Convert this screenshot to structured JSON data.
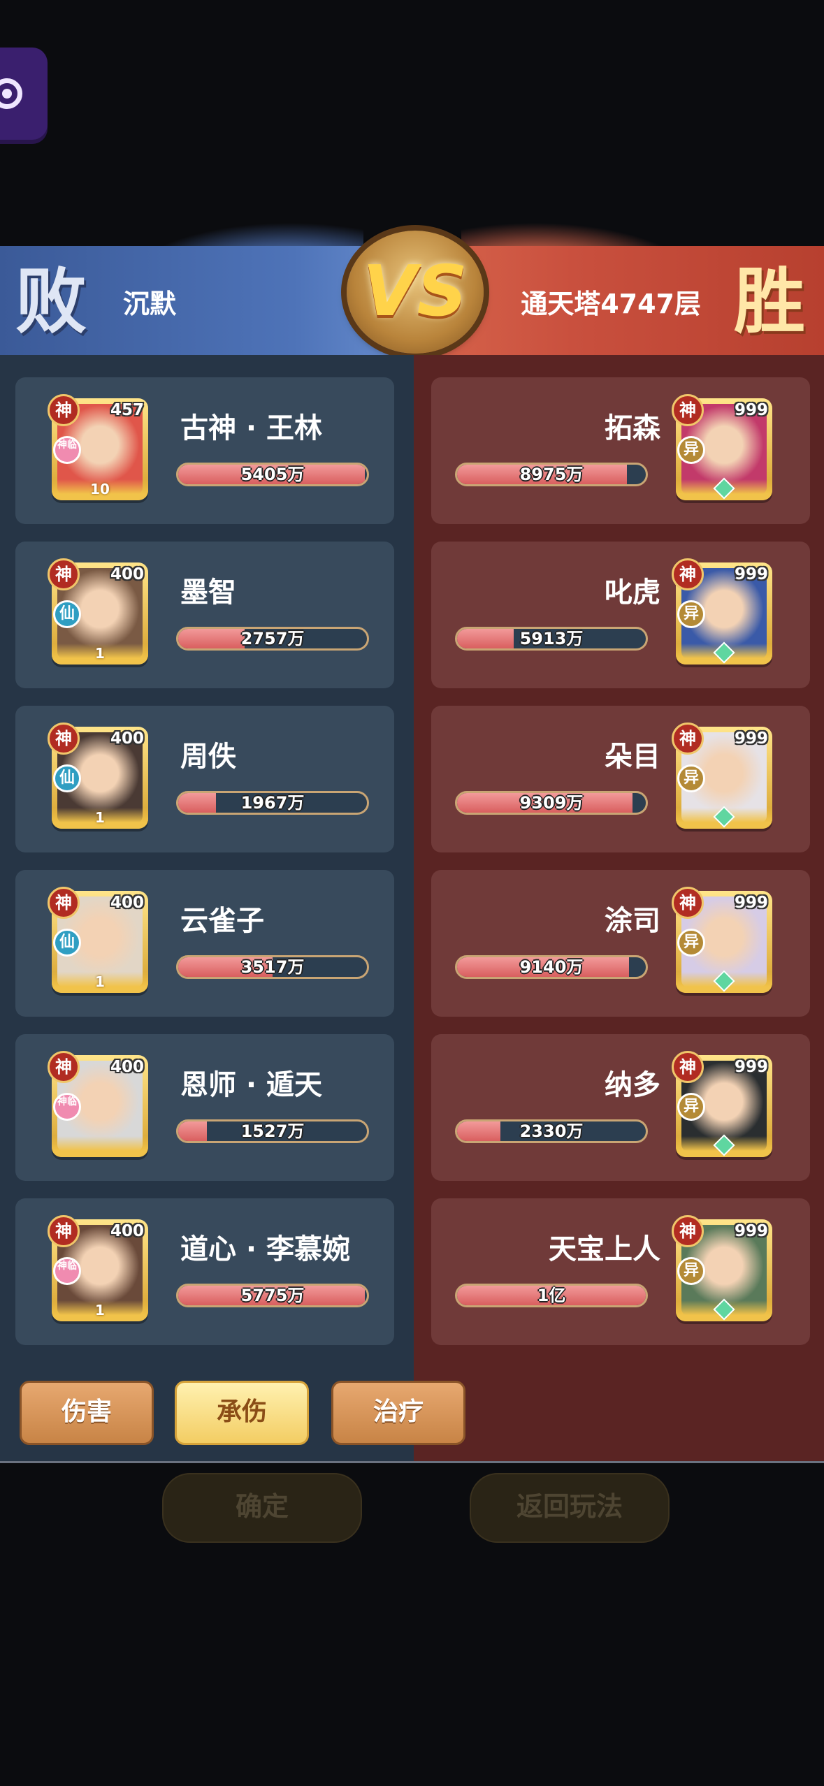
{
  "banner": {
    "left_result": "败",
    "left_name": "沉默",
    "vs": "VS",
    "right_name": "通天塔4747层",
    "right_result": "胜"
  },
  "colors": {
    "left_team": "#263546",
    "right_team": "#5a2423",
    "bar_fill": "#e06a6a",
    "bar_border": "#c9a574"
  },
  "left_heroes": [
    {
      "name": "古神 · 王林",
      "level": "457",
      "badge": "神",
      "sub": "神临",
      "stars": "10",
      "damage": "5405万",
      "ratio": 0.99,
      "skin": "#e0564a"
    },
    {
      "name": "墨智",
      "level": "400",
      "badge": "神",
      "sub": "仙",
      "stars": "1",
      "damage": "2757万",
      "ratio": 0.35,
      "skin": "#7a5a44"
    },
    {
      "name": "周佚",
      "level": "400",
      "badge": "神",
      "sub": "仙",
      "stars": "1",
      "damage": "1967万",
      "ratio": 0.2,
      "skin": "#4a3a34"
    },
    {
      "name": "云雀子",
      "level": "400",
      "badge": "神",
      "sub": "仙",
      "stars": "1",
      "damage": "3517万",
      "ratio": 0.5,
      "skin": "#e2d6c6"
    },
    {
      "name": "恩师 · 遁天",
      "level": "400",
      "badge": "神",
      "sub": "神临",
      "stars": "",
      "damage": "1527万",
      "ratio": 0.15,
      "skin": "#d8d8d8"
    },
    {
      "name": "道心 · 李慕婉",
      "level": "400",
      "badge": "神",
      "sub": "神临",
      "stars": "1",
      "damage": "5775万",
      "ratio": 0.99,
      "skin": "#6a4a3a"
    }
  ],
  "right_heroes": [
    {
      "name": "拓森",
      "level": "999",
      "badge": "神",
      "sub": "异",
      "damage": "8975万",
      "ratio": 0.9,
      "skin": "#c23a6a"
    },
    {
      "name": "叱虎",
      "level": "999",
      "badge": "神",
      "sub": "异",
      "damage": "5913万",
      "ratio": 0.3,
      "skin": "#3a5aa8"
    },
    {
      "name": "朵目",
      "level": "999",
      "badge": "神",
      "sub": "异",
      "damage": "9309万",
      "ratio": 0.93,
      "skin": "#e6e2e6"
    },
    {
      "name": "涂司",
      "level": "999",
      "badge": "神",
      "sub": "异",
      "damage": "9140万",
      "ratio": 0.91,
      "skin": "#d6cce6"
    },
    {
      "name": "纳多",
      "level": "999",
      "badge": "神",
      "sub": "异",
      "damage": "2330万",
      "ratio": 0.23,
      "skin": "#2a2e30"
    },
    {
      "name": "天宝上人",
      "level": "999",
      "badge": "神",
      "sub": "异",
      "damage": "1亿",
      "ratio": 1.0,
      "skin": "#5a7a5a"
    }
  ],
  "tabs": [
    {
      "label": "伤害",
      "active": false
    },
    {
      "label": "承伤",
      "active": true
    },
    {
      "label": "治疗",
      "active": false
    }
  ],
  "bottom_buttons": {
    "confirm": "确定",
    "back": "返回玩法"
  },
  "icons": {
    "exit": "exit-icon"
  }
}
